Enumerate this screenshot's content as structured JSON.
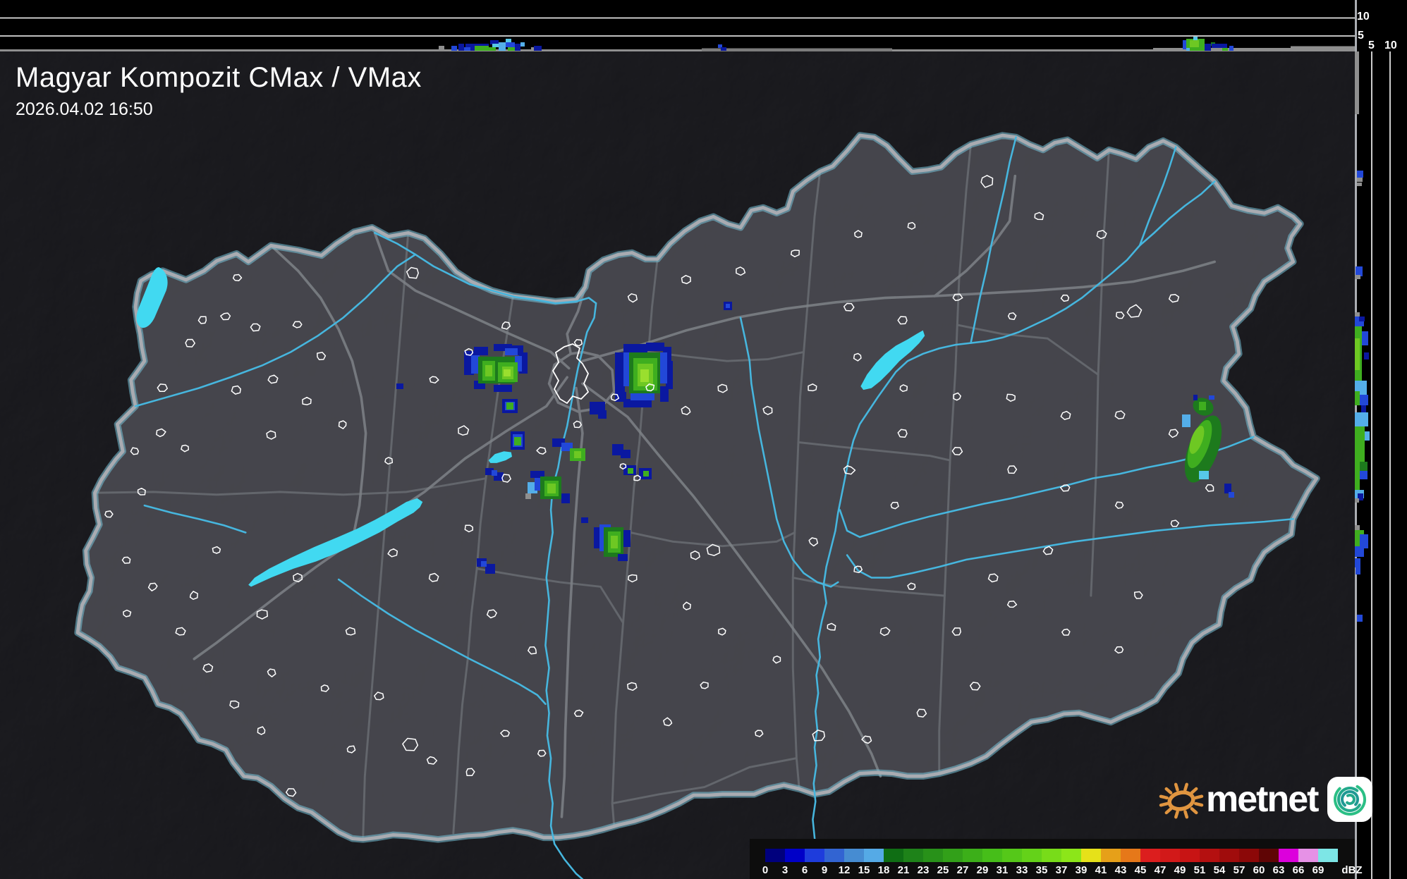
{
  "header": {
    "title": "Magyar Kompozit CMax / VMax",
    "timestamp": "2026.04.02 16:50"
  },
  "axes": {
    "top_height_upper_km": "10",
    "top_height_lower_km": "5",
    "right_dist_first_km": "5",
    "right_dist_second_km": "10"
  },
  "colorbar": {
    "unit": "dBZ",
    "ticks": [
      "0",
      "3",
      "6",
      "9",
      "12",
      "15",
      "18",
      "21",
      "23",
      "25",
      "27",
      "29",
      "31",
      "33",
      "35",
      "37",
      "39",
      "41",
      "43",
      "45",
      "47",
      "49",
      "51",
      "54",
      "57",
      "60",
      "63",
      "66",
      "69"
    ],
    "colors": [
      "#00007d",
      "#0000c8",
      "#1e3cdc",
      "#3264d2",
      "#468cd2",
      "#55aae6",
      "#0f6e14",
      "#1e8219",
      "#289119",
      "#32a019",
      "#3caf19",
      "#46be19",
      "#55c819",
      "#64d219",
      "#78dc19",
      "#8ce619",
      "#e6e119",
      "#e6a019",
      "#e67819",
      "#dc1e1e",
      "#d21919",
      "#c81414",
      "#b41010",
      "#a00c0c",
      "#8c0808",
      "#5f0505",
      "#dc00dc",
      "#e691e6",
      "#7de6e6"
    ]
  },
  "logo": {
    "text": "metnet",
    "sun_color": "#e09540",
    "spiral_color": "#23a98c"
  },
  "map_colors": {
    "terrain_outside": "#2e2e33",
    "terrain_inside": "#4a4a51",
    "country_border": "#a9abb1",
    "border_glow": "#79c2d8",
    "county_border": "#63666c",
    "road": "#7e8287",
    "river": "#46b6de",
    "lake": "#41d9f1",
    "city_outline": "#ffffff",
    "panel_bg": "#000000",
    "grid_line": "#ffffff",
    "ground_bar": "#8f8f8f"
  }
}
